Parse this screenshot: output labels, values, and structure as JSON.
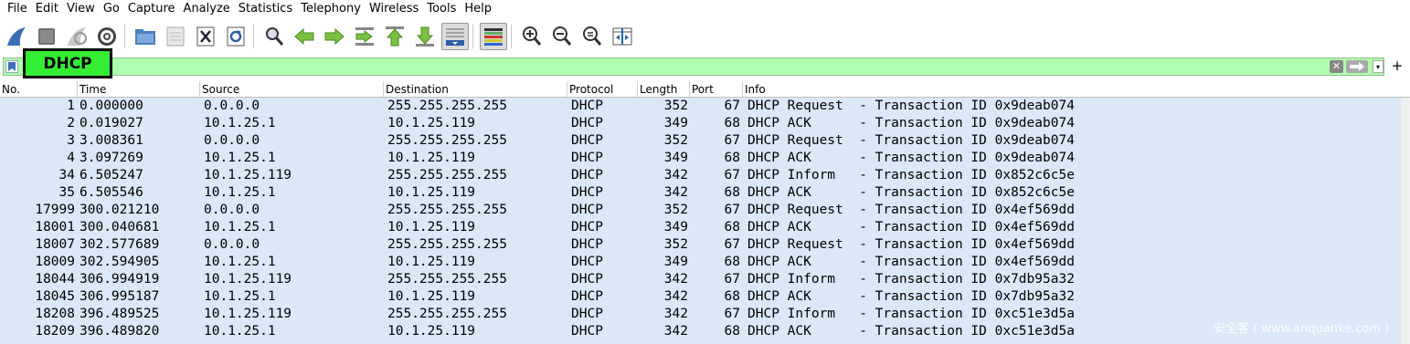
{
  "menu": [
    "File",
    "Edit",
    "View",
    "Go",
    "Capture",
    "Analyze",
    "Statistics",
    "Telephony",
    "Wireless",
    "Tools",
    "Help"
  ],
  "toolbar_icons": [
    "shark-fin-start-icon",
    "stop-capture-icon",
    "restart-capture-icon",
    "capture-options-gear-icon",
    "open-folder-icon",
    "save-file-icon",
    "close-file-icon",
    "reload-icon",
    "find-packet-icon",
    "go-back-icon",
    "go-forward-icon",
    "go-to-packet-icon",
    "go-first-icon",
    "go-last-icon",
    "autoscroll-icon",
    "colorize-icon",
    "zoom-in-icon",
    "zoom-out-icon",
    "zoom-normal-icon",
    "resize-columns-icon"
  ],
  "filter": {
    "value": "DHCP",
    "background": "#afffaf",
    "add_label": "+"
  },
  "columns": [
    "No.",
    "Time",
    "Source",
    "Destination",
    "Protocol",
    "Length",
    "Port",
    "Info"
  ],
  "rows": [
    {
      "no": "1",
      "time": "0.000000",
      "src": "0.0.0.0",
      "dst": "255.255.255.255",
      "proto": "DHCP",
      "len": "352",
      "port": "67",
      "info": "DHCP Request  - Transaction ID 0x9deab074"
    },
    {
      "no": "2",
      "time": "0.019027",
      "src": "10.1.25.1",
      "dst": "10.1.25.119",
      "proto": "DHCP",
      "len": "349",
      "port": "68",
      "info": "DHCP ACK      - Transaction ID 0x9deab074"
    },
    {
      "no": "3",
      "time": "3.008361",
      "src": "0.0.0.0",
      "dst": "255.255.255.255",
      "proto": "DHCP",
      "len": "352",
      "port": "67",
      "info": "DHCP Request  - Transaction ID 0x9deab074"
    },
    {
      "no": "4",
      "time": "3.097269",
      "src": "10.1.25.1",
      "dst": "10.1.25.119",
      "proto": "DHCP",
      "len": "349",
      "port": "68",
      "info": "DHCP ACK      - Transaction ID 0x9deab074"
    },
    {
      "no": "34",
      "time": "6.505247",
      "src": "10.1.25.119",
      "dst": "255.255.255.255",
      "proto": "DHCP",
      "len": "342",
      "port": "67",
      "info": "DHCP Inform   - Transaction ID 0x852c6c5e"
    },
    {
      "no": "35",
      "time": "6.505546",
      "src": "10.1.25.1",
      "dst": "10.1.25.119",
      "proto": "DHCP",
      "len": "342",
      "port": "68",
      "info": "DHCP ACK      - Transaction ID 0x852c6c5e"
    },
    {
      "no": "17999",
      "time": "300.021210",
      "src": "0.0.0.0",
      "dst": "255.255.255.255",
      "proto": "DHCP",
      "len": "352",
      "port": "67",
      "info": "DHCP Request  - Transaction ID 0x4ef569dd"
    },
    {
      "no": "18001",
      "time": "300.040681",
      "src": "10.1.25.1",
      "dst": "10.1.25.119",
      "proto": "DHCP",
      "len": "349",
      "port": "68",
      "info": "DHCP ACK      - Transaction ID 0x4ef569dd"
    },
    {
      "no": "18007",
      "time": "302.577689",
      "src": "0.0.0.0",
      "dst": "255.255.255.255",
      "proto": "DHCP",
      "len": "352",
      "port": "67",
      "info": "DHCP Request  - Transaction ID 0x4ef569dd"
    },
    {
      "no": "18009",
      "time": "302.594905",
      "src": "10.1.25.1",
      "dst": "10.1.25.119",
      "proto": "DHCP",
      "len": "349",
      "port": "68",
      "info": "DHCP ACK      - Transaction ID 0x4ef569dd"
    },
    {
      "no": "18044",
      "time": "306.994919",
      "src": "10.1.25.119",
      "dst": "255.255.255.255",
      "proto": "DHCP",
      "len": "342",
      "port": "67",
      "info": "DHCP Inform   - Transaction ID 0x7db95a32"
    },
    {
      "no": "18045",
      "time": "306.995187",
      "src": "10.1.25.1",
      "dst": "10.1.25.119",
      "proto": "DHCP",
      "len": "342",
      "port": "68",
      "info": "DHCP ACK      - Transaction ID 0x7db95a32"
    },
    {
      "no": "18208",
      "time": "396.489525",
      "src": "10.1.25.119",
      "dst": "255.255.255.255",
      "proto": "DHCP",
      "len": "342",
      "port": "67",
      "info": "DHCP Inform   - Transaction ID 0xc51e3d5a"
    },
    {
      "no": "18209",
      "time": "396.489820",
      "src": "10.1.25.1",
      "dst": "10.1.25.119",
      "proto": "DHCP",
      "len": "342",
      "port": "68",
      "info": "DHCP ACK      - Transaction ID 0xc51e3d5a"
    }
  ],
  "row_background": "#dae8f8",
  "watermark": "安全客 ( www.anquanke.com )"
}
